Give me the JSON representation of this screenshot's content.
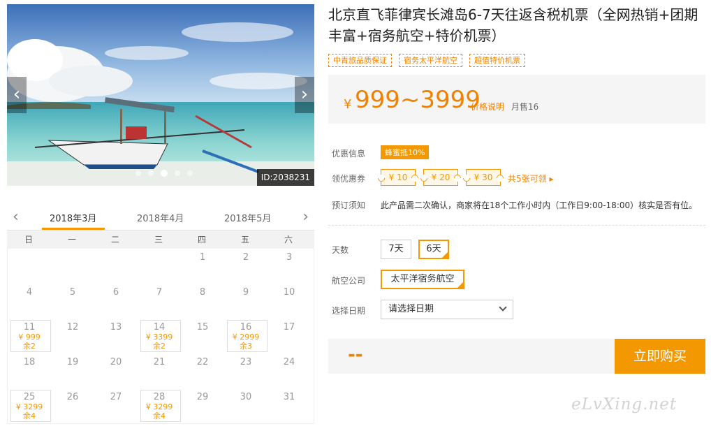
{
  "hero": {
    "image_desc": "outrigger-boat-on-beach-photo",
    "id_label": "ID:2038231",
    "dots": 5,
    "active_dot": 2
  },
  "product": {
    "title": "北京直飞菲律宾长滩岛6-7天往返含税机票（全网热销+团期丰富+宿务航空+特价机票）",
    "tags": [
      "中青旅品质保证",
      "宿务太平洋航空",
      "超值特价机票"
    ],
    "price_symbol": "¥",
    "price_range": "999~3999",
    "price_note": "价格说明",
    "sold": "月售16"
  },
  "promo": {
    "label": "优惠信息",
    "tag": "蜂蜜抵10%"
  },
  "coupons": {
    "label": "领优惠券",
    "items": [
      "¥ 10",
      "¥ 20",
      "¥ 30"
    ],
    "more": "共5张可领 ▸"
  },
  "booking": {
    "label": "预订须知",
    "text": "此产品需二次确认，商家将在18个工作小时内（工作日9:00-18:00）核实是否有位。"
  },
  "options": {
    "days_label": "天数",
    "days": [
      "7天",
      "6天"
    ],
    "airline_label": "航空公司",
    "airline": "太平洋宿务航空",
    "date_label": "选择日期",
    "date_placeholder": "请选择日期"
  },
  "buy": {
    "total": "--",
    "button": "立即购买"
  },
  "calendar": {
    "months": [
      "2018年3月",
      "2018年4月",
      "2018年5月"
    ],
    "weekdays": [
      "日",
      "一",
      "二",
      "三",
      "四",
      "五",
      "六"
    ],
    "cells": [
      {
        "day": ""
      },
      {
        "day": ""
      },
      {
        "day": ""
      },
      {
        "day": ""
      },
      {
        "day": "1"
      },
      {
        "day": "2"
      },
      {
        "day": "3"
      },
      {
        "day": "4"
      },
      {
        "day": "5"
      },
      {
        "day": "6"
      },
      {
        "day": "7"
      },
      {
        "day": "8"
      },
      {
        "day": "9"
      },
      {
        "day": "10"
      },
      {
        "day": "11",
        "price": "¥ 999",
        "left": "余2"
      },
      {
        "day": "12"
      },
      {
        "day": "13"
      },
      {
        "day": "14",
        "price": "¥ 3399",
        "left": "余2"
      },
      {
        "day": "15"
      },
      {
        "day": "16",
        "price": "¥ 2999",
        "left": "余3"
      },
      {
        "day": "17"
      },
      {
        "day": "18"
      },
      {
        "day": "19"
      },
      {
        "day": "20"
      },
      {
        "day": "21"
      },
      {
        "day": "22"
      },
      {
        "day": "23"
      },
      {
        "day": "24"
      },
      {
        "day": "25",
        "price": "¥ 3299",
        "left": "余4"
      },
      {
        "day": "26"
      },
      {
        "day": "27"
      },
      {
        "day": "28",
        "price": "¥ 3299",
        "left": "余4"
      },
      {
        "day": "29"
      },
      {
        "day": "30"
      },
      {
        "day": "31"
      }
    ]
  },
  "watermark": "eLvXing.net",
  "colors": {
    "accent": "#f39800",
    "price": "#f08200"
  }
}
